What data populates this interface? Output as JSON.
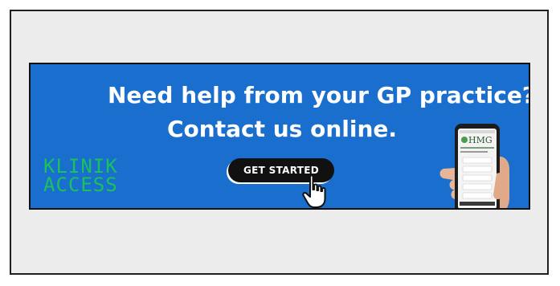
{
  "banner": {
    "headline_line1": "Need help from your GP practice?",
    "headline_line2": "Contact us online.",
    "cta_label": "GET STARTED",
    "logo_line1": "KLINIK",
    "logo_line2": "ACCESS",
    "phone_brand": "HMG"
  },
  "colors": {
    "banner_background": "#1a6fce",
    "logo_green": "#19c25a",
    "cta_background": "#111111"
  },
  "icons": [
    "hand-pointer-icon",
    "phone-in-hand-image"
  ]
}
